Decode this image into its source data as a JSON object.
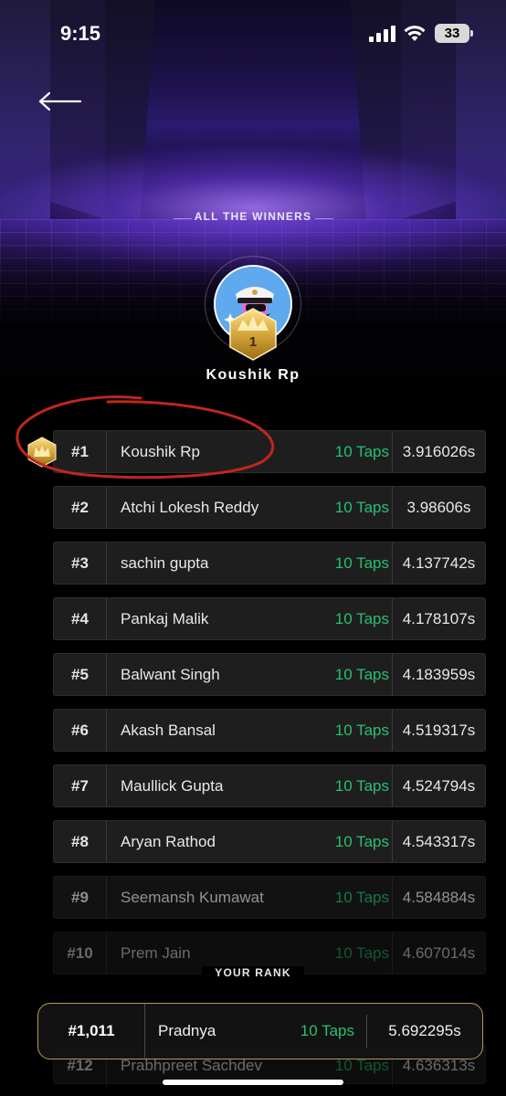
{
  "status_bar": {
    "time": "9:15",
    "battery": "33"
  },
  "winners": {
    "heading": "ALL THE WINNERS",
    "top_winner": {
      "rank": "1",
      "name": "Koushik Rp"
    }
  },
  "leaderboard": [
    {
      "rank": "#1",
      "name": "Koushik Rp",
      "taps": "10 Taps",
      "time": "3.916026s"
    },
    {
      "rank": "#2",
      "name": "Atchi Lokesh Reddy",
      "taps": "10 Taps",
      "time": "3.98606s"
    },
    {
      "rank": "#3",
      "name": "sachin gupta",
      "taps": "10 Taps",
      "time": "4.137742s"
    },
    {
      "rank": "#4",
      "name": "Pankaj Malik",
      "taps": "10 Taps",
      "time": "4.178107s"
    },
    {
      "rank": "#5",
      "name": "Balwant Singh",
      "taps": "10 Taps",
      "time": "4.183959s"
    },
    {
      "rank": "#6",
      "name": "Akash Bansal",
      "taps": "10 Taps",
      "time": "4.519317s"
    },
    {
      "rank": "#7",
      "name": "Maullick Gupta",
      "taps": "10 Taps",
      "time": "4.524794s"
    },
    {
      "rank": "#8",
      "name": "Aryan Rathod",
      "taps": "10 Taps",
      "time": "4.543317s"
    },
    {
      "rank": "#9",
      "name": "Seemansh Kumawat",
      "taps": "10 Taps",
      "time": "4.584884s"
    },
    {
      "rank": "#10",
      "name": "Prem Jain",
      "taps": "10 Taps",
      "time": "4.607014s"
    },
    {
      "rank": "#12",
      "name": "Prabhpreet Sachdev",
      "taps": "10 Taps",
      "time": "4.636313s"
    }
  ],
  "your_rank": {
    "label": "YOUR RANK",
    "rank": "#1,011",
    "name": "Pradnya",
    "taps": "10 Taps",
    "time": "5.692295s"
  },
  "colors": {
    "taps_green": "#27c06f",
    "gold": "#d4a63a",
    "annotation_red": "#c0261d"
  }
}
